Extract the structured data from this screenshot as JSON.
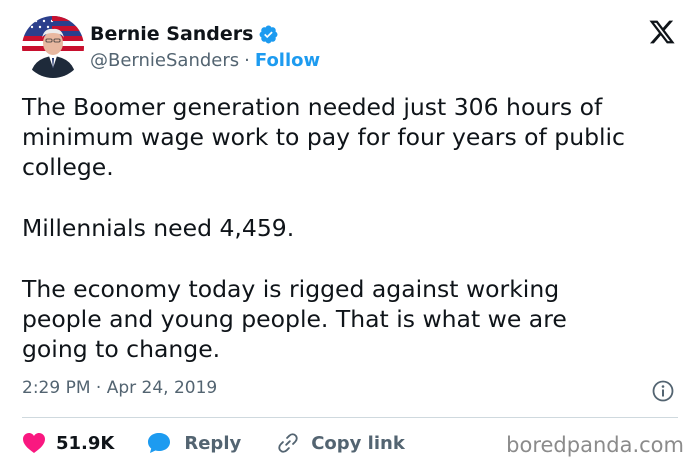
{
  "tweet": {
    "author_name": "Bernie Sanders",
    "handle": "@BernieSanders",
    "separator": "·",
    "follow_label": "Follow",
    "paragraphs": [
      "The Boomer generation needed just 306 hours of\nminimum wage work to pay for four years of public\ncollege.",
      "Millennials need 4,459.",
      "The economy today is rigged against working\npeople and young people. That is what we are\ngoing to change."
    ],
    "timestamp": "2:29 PM · Apr 24, 2019",
    "likes": "51.9K",
    "reply_label": "Reply",
    "copy_link_label": "Copy link"
  },
  "watermark": "boredpanda.com",
  "colors": {
    "accent": "#1d9bf0",
    "like": "#f91880",
    "text": "#0f1419",
    "secondary": "#536471"
  },
  "icons": [
    "verified-badge-icon",
    "x-logo-icon",
    "info-icon",
    "heart-icon",
    "reply-bubble-icon",
    "link-icon"
  ]
}
